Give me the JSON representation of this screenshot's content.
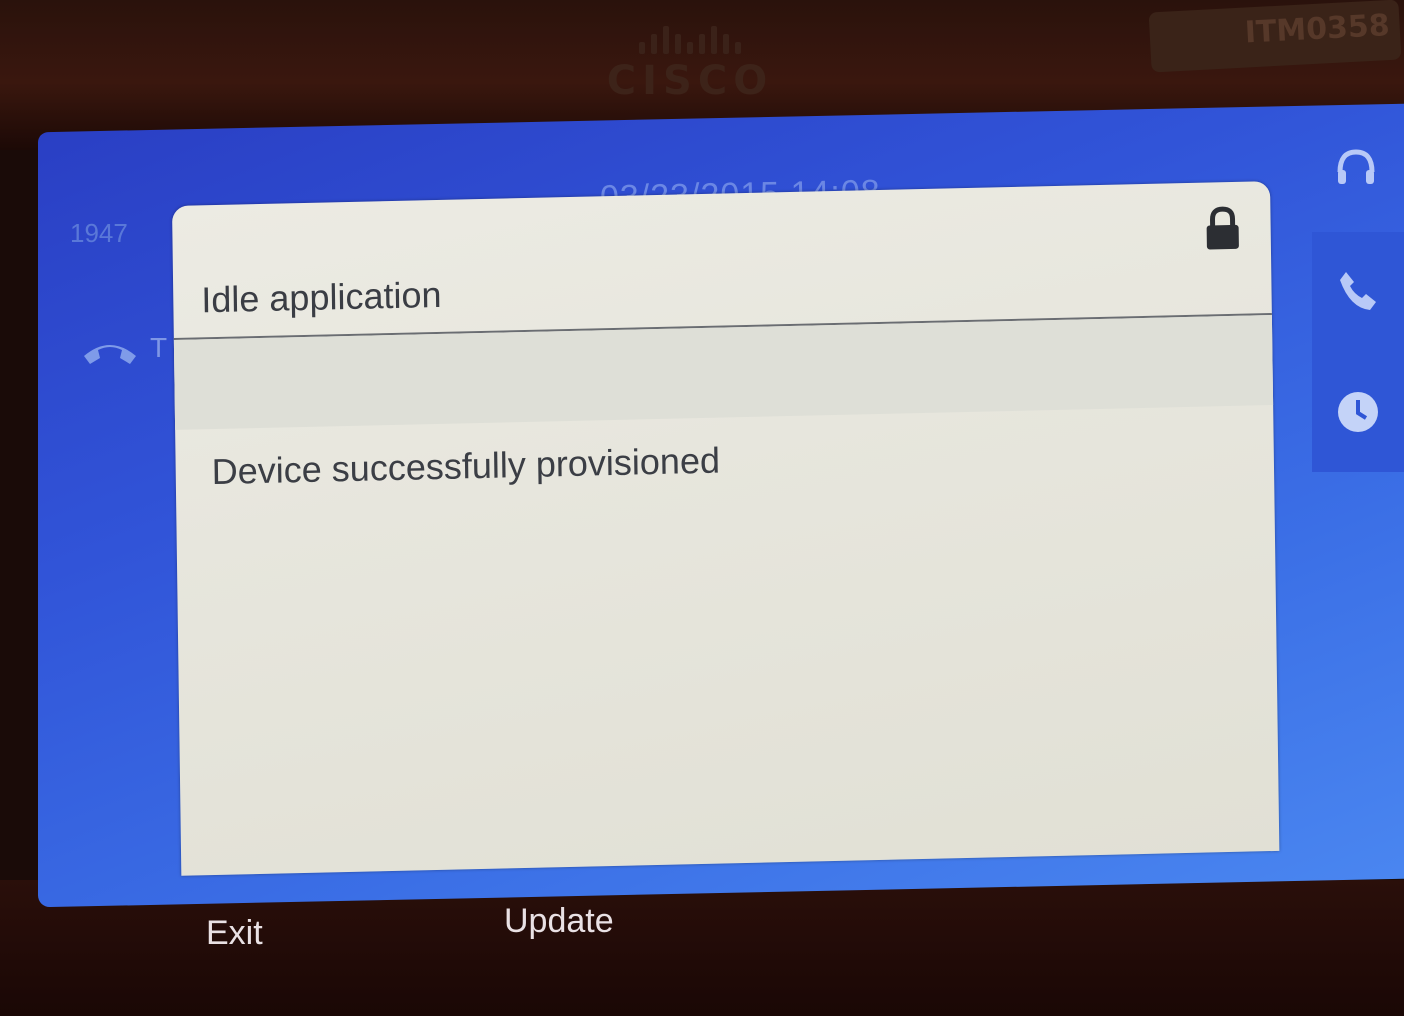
{
  "brand": {
    "name": "CISCO"
  },
  "asset_tag": "ITM0358",
  "status_bar": {
    "line": "1947",
    "datetime": "03/23/2015 14:08"
  },
  "left_panel": {
    "label": "T"
  },
  "dialog": {
    "title": "Idle application",
    "message": "Device successfully provisioned"
  },
  "softkeys": {
    "exit_label": "Exit",
    "update_label": "Update"
  },
  "icons": {
    "lock": "lock-icon",
    "headset": "headset-icon",
    "phone": "phone-icon",
    "history": "clock-icon",
    "handset": "handset-icon"
  },
  "colors": {
    "screen_blue": "#3154d8",
    "dialog_bg": "#ecebe3",
    "text_dark": "#3a3d44",
    "softkey_text": "#e9e1e4"
  }
}
